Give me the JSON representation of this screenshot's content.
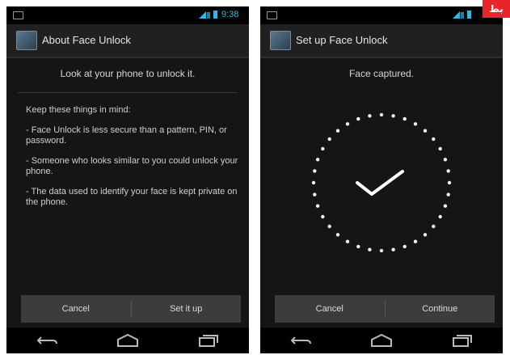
{
  "left_screen": {
    "status": {
      "time": "9:38"
    },
    "title": "About Face Unlock",
    "headline": "Look at your phone to unlock it.",
    "intro": "Keep these things in mind:",
    "bullets": [
      "- Face Unlock is less secure than a pattern, PIN, or password.",
      "- Someone who looks similar to you could unlock your phone.",
      "- The data used to identify your face is kept private on the phone."
    ],
    "buttons": {
      "cancel": "Cancel",
      "confirm": "Set it up"
    }
  },
  "right_screen": {
    "title": "Set up Face Unlock",
    "headline": "Face captured.",
    "buttons": {
      "cancel": "Cancel",
      "confirm": "Continue"
    }
  },
  "icons": {
    "status": [
      "notification-icon",
      "signal-icon",
      "battery-icon"
    ],
    "nav": [
      "back-icon",
      "home-icon",
      "recent-apps-icon"
    ],
    "progress": "checkmark-icon"
  },
  "colors": {
    "accent": "#33b5e5",
    "background": "#151515"
  },
  "logo_text": "بط"
}
